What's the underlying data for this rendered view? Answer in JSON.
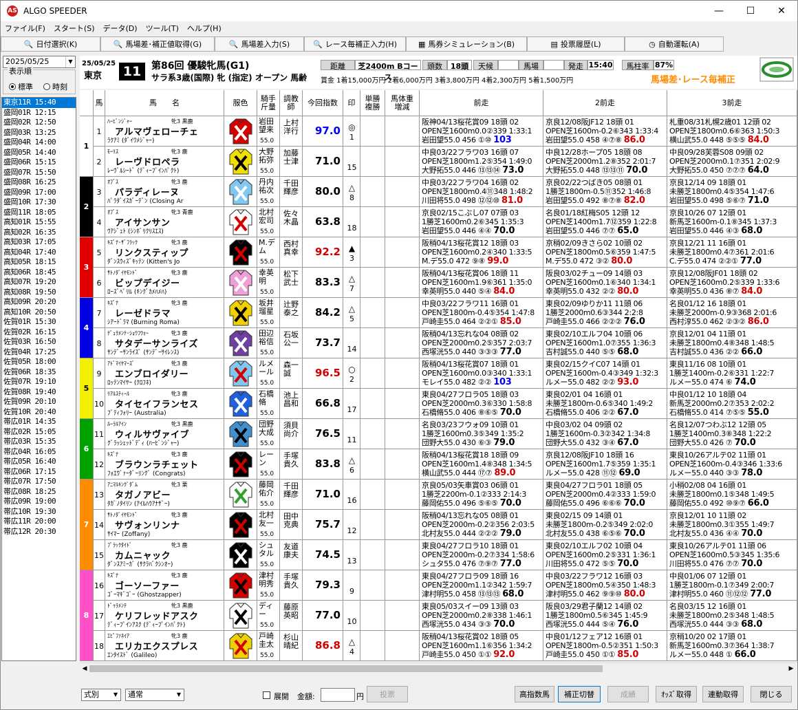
{
  "app": {
    "title": "ALGO SPEEDER",
    "logo": "AS"
  },
  "window_controls": {
    "minimize": "—",
    "maximize": "☐",
    "close": "✕"
  },
  "menu": [
    "ファイル(F)",
    "スタート(S)",
    "データ(D)",
    "ツール(T)",
    "ヘルプ(H)"
  ],
  "toolbar": [
    {
      "label": "日付選択(K)",
      "icon": "search-icon"
    },
    {
      "label": "馬場差･補正値取得(G)",
      "icon": "search-icon"
    },
    {
      "label": "馬場差入力(S)",
      "icon": "search-icon"
    },
    {
      "label": "レース毎補正入力(H)",
      "icon": "search-icon"
    },
    {
      "label": "馬券シミュレーション(B)",
      "icon": "grid-icon"
    },
    {
      "label": "投票履歴(L)",
      "icon": "doc-icon"
    },
    {
      "label": "自動運転(A)",
      "icon": "clock-icon"
    }
  ],
  "date_select": "2025/05/25",
  "order": {
    "legend": "表示順",
    "options": [
      "標準",
      "時刻"
    ],
    "selected": "標準"
  },
  "races": [
    "東京11R 15:40",
    "盛岡01R 12:15",
    "盛岡02R 12:50",
    "盛岡03R 13:25",
    "盛岡04R 14:00",
    "盛岡05R 14:40",
    "盛岡06R 15:15",
    "盛岡07R 15:50",
    "盛岡08R 16:25",
    "盛岡09R 17:00",
    "盛岡10R 17:30",
    "盛岡11R 18:05",
    "高知01R 15:55",
    "高知02R 16:35",
    "高知03R 17:05",
    "高知04R 17:40",
    "高知05R 18:15",
    "高知06R 18:45",
    "高知07R 19:20",
    "高知08R 19:50",
    "高知09R 20:20",
    "高知10R 20:50",
    "佐賀01R 15:30",
    "佐賀02R 16:15",
    "佐賀03R 16:50",
    "佐賀04R 17:25",
    "佐賀05R 18:00",
    "佐賀06R 18:35",
    "佐賀07R 19:10",
    "佐賀08R 19:40",
    "佐賀09R 20:10",
    "佐賀10R 20:40",
    "帯広01R 14:35",
    "帯広02R 15:05",
    "帯広03R 15:35",
    "帯広04R 16:05",
    "帯広05R 16:40",
    "帯広06R 17:15",
    "帯広07R 17:50",
    "帯広08R 18:25",
    "帯広09R 19:00",
    "帯広10R 19:30",
    "帯広11R 20:00",
    "帯広12R 20:30"
  ],
  "race": {
    "date": "25/05/25",
    "venue": "東京",
    "number": "11",
    "name": "第86回 優駿牝馬(G1)",
    "condition": "サラ系3歳(国際) 牝 (指定) オープン 馬齢",
    "distance_label": "距離",
    "distance": "芝2400m Bコース",
    "heads_label": "頭数",
    "heads": "18頭",
    "weather_label": "天候",
    "weather": "",
    "going_label": "馬場",
    "going": "",
    "post_label": "発走",
    "post": "15:40",
    "turf_label": "馬柱率",
    "turf": "87%",
    "prize": "賞金 1着15,000万円 2着6,000万円 3着3,800万円 4着2,300万円 5着1,500万円",
    "notice": "馬場差･レース毎補正"
  },
  "columns": {
    "waku": "",
    "num": "馬",
    "name": "馬　　名",
    "silk": "服色",
    "jockey": "騎手\n斤量",
    "trainer": "調教\n師",
    "index": "今回指数",
    "mark": "印",
    "odds": "単勝\n複勝",
    "weight": "馬体重\n増減",
    "p1": "前走",
    "p2": "2前走",
    "p3": "3前走"
  },
  "horses": [
    {
      "waku": 1,
      "num": "1",
      "sire": "ﾊｰﾋﾞﾝｼﾞｬｰ",
      "name": "アルマヴェローチェ",
      "sex": "牝3 黒鹿",
      "dam": "ﾗｸｱﾐ (ﾀﾞｲﾜﾒｼﾞｬｰ)",
      "jockey": "岩田望来",
      "jw": "55.0",
      "trainer": "上村洋行",
      "index": "97.0",
      "ic": "#0000ff",
      "mark": "◎",
      "pop": "1",
      "silk": "#d40000",
      "silk2": "#ffffff",
      "p1": [
        "阪神04/13桜花賞09 18頭 02",
        "OPEN芝1600m0.0②339 1:33:1",
        "岩田望55.0 456 ①⑩ 103"
      ],
      "p2": [
        "京良12/08阪JF12 18頭 01",
        "OPEN芝1600m-0.2⑥343 1:33:4",
        "岩田望55.0 458 ④⑦⑧ 86.0"
      ],
      "p3": [
        "札重08/31札幌2歳01 12頭 02",
        "OPEN芝1800m0.6⑥363 1:50:3",
        "横山武55.0 448 ⑤⑤⑤ 84.0"
      ]
    },
    {
      "waku": 1,
      "num": "2",
      "sire": "ﾓｰﾘｽ",
      "name": "レーヴドロペラ",
      "sex": "牝3 鹿",
      "dam": "ﾚｰｳﾞﾙｼｰﾄﾞ (ﾃﾞｨｰﾌﾟｲﾝﾊﾟｸﾄ)",
      "jockey": "大野拓弥",
      "jw": "55.0",
      "trainer": "加藤士津",
      "index": "71.0",
      "ic": "#000000",
      "mark": "",
      "pop": "15",
      "silk": "#f0e000",
      "silk2": "#000000",
      "p1": [
        "中良03/22フラワ03 16頭 07",
        "OPEN芝1800m1.2⑤354 1:49:0",
        "大野拓55.0 446 ⑬⑬⑭ 73.0"
      ],
      "p2": [
        "中良12/28ホープ05 18頭 08",
        "OPEN芝2000m1.2⑧352 2:01:7",
        "大野拓55.0 448 ⑬⑬⑪ 70.0"
      ],
      "p3": [
        "中良09/28芙蓉S08 09頭 02",
        "OPEN芝2000m0.1⑦351 2:02:9",
        "大野拓55.0 450 ⑦⑦⑦ 64.0"
      ]
    },
    {
      "waku": 2,
      "num": "3",
      "sire": "ｵﾌﾞｽ",
      "name": "パラディレーヌ",
      "sex": "牝3 鹿",
      "dam": "ﾊﾟﾗﾀﾞｲｽｶﾞｰﾃﾞﾝ (Closing Ar",
      "jockey": "丹内祐次",
      "jw": "55.0",
      "trainer": "千田輝彦",
      "index": "80.0",
      "ic": "#000000",
      "mark": "△",
      "pop": "8",
      "silk": "#80c8f0",
      "silk2": "#ffffff",
      "p1": [
        "中良03/22フラワ04 16頭 02",
        "OPEN芝1800m0.4⑪348 1:48:2",
        "川田将55.0 498 ⑫⑫⑩ 81.0"
      ],
      "p2": [
        "京良02/22つばき05 08頭 01",
        "1勝芝1800m-0.5⑪352 1:46:8",
        "岩田望55.0 492 ⑧⑦⑧ 82.0"
      ],
      "p3": [
        "京良12/14 09 18頭 01",
        "未勝芝1800m0.4⑤354 1:47:6",
        "岩田望55.0 498 ⑤⑥⑦ 71.0"
      ]
    },
    {
      "waku": 2,
      "num": "4",
      "sire": "ｵﾌﾞｽ",
      "name": "アイサンサン",
      "sex": "牝3 青鹿",
      "dam": "ｳｱｼﾞｪﾄ (ｼﾝﾎﾞﾘｸﾘｽｴｽ)",
      "jockey": "北村宏司",
      "jw": "55.0",
      "trainer": "佐々木晶",
      "index": "63.8",
      "ic": "#000000",
      "mark": "",
      "pop": "18",
      "silk": "#ffffff",
      "silk2": "#d40000",
      "p1": [
        "京良02/15こぶし07 07頭 03",
        "1勝芝1600m0.2⑥345 1:35:3",
        "岩田望55.0 446 ④④ 70.0"
      ],
      "p2": [
        "名良01/18紅梅S05 12頭 12",
        "OPEN芝1400m1.7⑫359 1:22:8",
        "岩田望55.0 446 ⑦⑦ 65.0"
      ],
      "p3": [
        "京良10/26 07 12頭 01",
        "新馬芝1600m-0.1⑧345 1:37:3",
        "岩田望55.0 446 ④③ 68.0"
      ]
    },
    {
      "waku": 3,
      "num": "5",
      "sire": "ｷｽﾞﾅ･ｻﾞﾌﾗｯｸ",
      "name": "リンクスティップ",
      "sex": "牝3 鹿",
      "dam": "ﾀﾞﾝｽｳｨｽﾞｷｯﾃﾝ (Kitten's Jo",
      "jockey": "M.デム",
      "jw": "55.0",
      "trainer": "西村真幸",
      "index": "92.2",
      "ic": "#d40000",
      "mark": "▲",
      "pop": "3",
      "silk": "#000000",
      "silk2": "#d40000",
      "p1": [
        "阪稍04/13桜花賞12 18頭 03",
        "OPEN芝1600m0.2④340 1:33:5",
        "M.デ55.0 472 ⑨⑧ 99.0"
      ],
      "p2": [
        "京稍02/09きさら02 10頭 02",
        "OPEN芝1800m0.5⑥359 1:47:5",
        "M.デ55.0 472 ③② 80.0"
      ],
      "p3": [
        "京良12/21 11 16頭 01",
        "未勝芝1800m0.4⑦361 2:01:6",
        "C.デ55.0 474 ②②① 77.0"
      ]
    },
    {
      "waku": 3,
      "num": "6",
      "sire": "ｻﾄﾉﾀﾞｲﾔﾓﾝﾄﾞ",
      "name": "ビップデイジー",
      "sex": "牝3 鹿",
      "dam": "ﾛｰｽﾞﾍﾟﾘﾙ (ｷﾝｸﾞｶﾒﾊﾒﾊ)",
      "jockey": "幸英明",
      "jw": "55.0",
      "trainer": "松下武士",
      "index": "83.3",
      "ic": "#000000",
      "mark": "△",
      "pop": "7",
      "silk": "#f0a0d8",
      "silk2": "#ffffff",
      "p1": [
        "阪稍04/13桜花賞06 18頭 11",
        "OPEN芝1600m1.9⑥361 1:35:0",
        "幸英明55.0 440 ⑤④ 84.0"
      ],
      "p2": [
        "阪良03/02チュー09 14頭 03",
        "OPEN芝1600m0.1⑥340 1:34:1",
        "幸英明55.0 432 ②② 80.0"
      ],
      "p3": [
        "京良12/08阪JF01 18頭 02",
        "OPEN芝1600m0.2⑤339 1:33:6",
        "幸英明55.0 436 ⑧⑦ 84.0"
      ]
    },
    {
      "waku": 4,
      "num": "7",
      "sire": "ｷｽﾞﾅ",
      "name": "レーゼドラマ",
      "sex": "牝3 鹿",
      "dam": "ｼｱｰﾄﾞﾗﾏ (Burning Roma)",
      "jockey": "坂井瑠星",
      "jw": "55.0",
      "trainer": "辻野泰之",
      "index": "84.2",
      "ic": "#000000",
      "mark": "△",
      "pop": "5",
      "silk": "#f0d000",
      "silk2": "#000000",
      "p1": [
        "中良03/22フラワ11 16頭 01",
        "OPEN芝1800m-0.4⑤354 1:47:8",
        "戸崎圭55.0 464 ②②① 85.0"
      ],
      "p2": [
        "東良02/09ゆりか11 11頭 06",
        "1勝芝2000m0.6③344 2:2:8",
        "戸崎圭55.0 466 ②②② 76.0"
      ],
      "p3": [
        "名良01/12 16 18頭 01",
        "未勝芝2000m-0.9③368 2:01:6",
        "西村淳55.0 462 ②③② 86.0"
      ]
    },
    {
      "waku": 4,
      "num": "8",
      "sire": "ﾃﾞｭﾗﾒﾝﾃ･ｼｮｳﾌｳｫｰ",
      "name": "サタデーサンライズ",
      "sex": "牝3 鹿",
      "dam": "ｻﾝﾃﾞｰｻﾝﾗｲｽﾞ (ｻﾝﾃﾞｰｻｲﾚﾝｽ)",
      "jockey": "田辺裕信",
      "jw": "55.0",
      "trainer": "石坂公一",
      "index": "73.7",
      "ic": "#000000",
      "mark": "",
      "pop": "14",
      "silk": "#7040a0",
      "silk2": "#ffffff",
      "p1": [
        "阪稍04/13忘れな04 08頭 02",
        "OPEN芝2000m0.2⑤357 2:03:7",
        "西塚洸55.0 440 ③③③ 77.0"
      ],
      "p2": [
        "東良02/10エルフ04 10頭 06",
        "OPEN芝1600m1.0⑦355 1:36:3",
        "吉村誠55.0 440 ⑤⑤ 68.0"
      ],
      "p3": [
        "京良12/01 04 11頭 01",
        "未勝芝1800m0.4⑧348 1:48:5",
        "吉村誠55.0 436 ②② 66.0"
      ]
    },
    {
      "waku": 5,
      "num": "9",
      "sire": "ｱﾄﾞﾏｲﾔﾏｰｽﾞ",
      "name": "エンブロイダリー",
      "sex": "牝3 鹿",
      "dam": "ﾛｯﾃﾝﾏｲﾔｰ (ｸﾛﾌﾈ)",
      "jockey": "ルメール",
      "jw": "55.0",
      "trainer": "森一誠",
      "index": "96.5",
      "ic": "#d40000",
      "mark": "○",
      "pop": "2",
      "silk": "#80c8f0",
      "silk2": "#d40000",
      "p1": [
        "阪稍04/13桜花賞07 18頭 01",
        "OPEN芝1600m0.0③340 1:33:1",
        "モレイ55.0 482 ②② 103"
      ],
      "p2": [
        "東良02/15クイC07 14頭 01",
        "OPEN芝1600m-0.4③349 1:32:3",
        "ルメー55.0 482 ②② 93.0"
      ],
      "p3": [
        "東良11/16 08 10頭 01",
        "1勝芝1400m-0.2⑥331 1:22:7",
        "ルメー55.0 474 ⑥ 74.0"
      ]
    },
    {
      "waku": 5,
      "num": "10",
      "sire": "ﾘｱﾙｽﾃｨｰﾙ",
      "name": "タイセイフランセス",
      "sex": "牝3 鹿",
      "dam": "ﾌﾞﾃｨﾌｫﾘｰ (Australia)",
      "jockey": "石橋脩",
      "jw": "55.0",
      "trainer": "池上昌和",
      "index": "66.8",
      "ic": "#000000",
      "mark": "",
      "pop": "17",
      "silk": "#2060e0",
      "silk2": "#ffffff",
      "p1": [
        "東良04/27フロラ05 18頭 03",
        "OPEN芝2000m0.3⑥330 1:58:8",
        "石橋脩55.0 406 ⑧⑥⑤ 70.0"
      ],
      "p2": [
        "東良02/01 04 16頭 01",
        "未勝芝1800m-0.6⑤340 1:49:2",
        "石橋脩55.0 406 ②② 67.0"
      ],
      "p3": [
        "中良01/12 10 18頭 04",
        "新馬芝2000m0.2⑦353 2:02:2",
        "石橋脩55.0 414 ⑦⑤⑤ 55.0"
      ]
    },
    {
      "waku": 6,
      "num": "11",
      "sire": "ﾙｰﾗﾙｱｲﾝ",
      "name": "ウィルサヴァイブ",
      "sex": "牝3 黒鹿",
      "dam": "ｸﾞﾗｯｼｪｯﾄﾞﾃﾞｨ (ﾊｰﾋﾞﾝｼﾞｬｰ)",
      "jockey": "団野大成",
      "jw": "55.0",
      "trainer": "須貝尚介",
      "index": "76.5",
      "ic": "#000000",
      "mark": "",
      "pop": "11",
      "silk": "#4090d0",
      "silk2": "#000000",
      "p1": [
        "名良03/23フウォ09 10頭 01",
        "1勝芝1600m0.3⑤349 1:35:2",
        "団野大55.0 430 ⑥③ 79.0"
      ],
      "p2": [
        "中良03/02 04 09頭 02",
        "1勝芝1600m-0.3②342 1:34:8",
        "団野大55.0 432 ③④ 67.0"
      ],
      "p3": [
        "名良12/07つわぶ12 12頭 05",
        "1勝芝1400m0.3⑧348 1:22:2",
        "団野大55.0 426 ⑦ 70.0"
      ]
    },
    {
      "waku": 6,
      "num": "12",
      "sire": "ｷｽﾞﾅ",
      "name": "ブラウンラチェット",
      "sex": "牝3 鹿",
      "dam": "ﾌｫｴｳﾞｧｰﾀﾞｰﾘﾝｸﾞ (Congrats)",
      "jockey": "レーン",
      "jw": "55.0",
      "trainer": "手塚貴久",
      "index": "83.8",
      "ic": "#000000",
      "mark": "△",
      "pop": "6",
      "silk": "#000000",
      "silk2": "#d40000",
      "p1": [
        "阪稍04/13桜花賞18 18頭 09",
        "OPEN芝1600m1.4⑧348 1:34:5",
        "横山武55.0 444 ⑰⑦ 89.0"
      ],
      "p2": [
        "京良12/08阪JF10 18頭 16",
        "OPEN芝1600m1.7⑤359 1:35:1",
        "ルメー55.0 428 ⑪⑫ 69.0"
      ],
      "p3": [
        "東良10/26アルテ02 11頭 01",
        "OPEN芝1600m-0.4③346 1:33:6",
        "ルメー55.0 440 ③③ 78.0"
      ]
    },
    {
      "waku": 7,
      "num": "13",
      "sire": "ｱﾆﾏﾙｷﾝｸﾞﾀﾞﾑ",
      "name": "タガノアビー",
      "sex": "牝3 栗",
      "dam": "ﾀｶﾞﾉﾀｲﾘﾝ (ｱｲﾙﾊｳｱﾅｻﾞｰ)",
      "jockey": "藤岡佑介",
      "jw": "55.0",
      "trainer": "千田輝彦",
      "index": "71.0",
      "ic": "#000000",
      "mark": "",
      "pop": "16",
      "silk": "#ffffff",
      "silk2": "#30a030",
      "p1": [
        "京良05/03矢車賞03 06頭 01",
        "1勝芝2200m-0.1②333 2:14:3",
        "藤岡佑55.0 496 ⑤⑥⑤ 70.0"
      ],
      "p2": [
        "東良04/27フロラ01 18頭 05",
        "OPEN芝2000m0.4②333 1:59:0",
        "藤岡佑55.0 496 ⑥⑥⑥ 70.0"
      ],
      "p3": [
        "小稍02/08 04 16頭 01",
        "未勝芝1800m0.1⑤348 1:49:5",
        "藤岡佑55.0 492 ⑩⑨⑦ 66.0"
      ]
    },
    {
      "waku": 7,
      "num": "14",
      "sire": "ｻﾄﾉﾀﾞｲﾔﾓﾝﾄﾞ",
      "name": "サヴォンリンナ",
      "sex": "牝3 鹿",
      "dam": "ｻｲﾏｰ (Zoffany)",
      "jockey": "北村友一",
      "jw": "55.0",
      "trainer": "田中克典",
      "index": "75.7",
      "ic": "#000000",
      "mark": "",
      "pop": "12",
      "silk": "#000000",
      "silk2": "#d40000",
      "p1": [
        "阪稍04/13忘れな05 08頭 01",
        "OPEN芝2000m-0.2②356 2:03:5",
        "北村友55.0 444 ②②② 79.0"
      ],
      "p2": [
        "東良02/15 09 14頭 01",
        "未勝芝1800m-0.2⑤349 2:02:0",
        "北村友55.0 438 ⑥⑤⑥ 70.0"
      ],
      "p3": [
        "京良12/01 10 11頭 02",
        "未勝芝1800m0.3①355 1:49:7",
        "北村友55.0 436 ④④ 70.0"
      ]
    },
    {
      "waku": 7,
      "num": "15",
      "sire": "ﾌﾞﾗｯｸﾀｲﾄﾞ",
      "name": "カムニャック",
      "sex": "牝3 鹿",
      "dam": "ﾀﾞﾝｽｱﾐｰｶﾞ (ｻｸﾗﾊﾞｸｼﾝｵｰ)",
      "jockey": "シュタル",
      "jw": "55.0",
      "trainer": "友道康夫",
      "index": "74.5",
      "ic": "#000000",
      "mark": "",
      "pop": "13",
      "silk": "#000000",
      "silk2": "#ffffff",
      "p1": [
        "東良04/27フロラ10 18頭 01",
        "OPEN芝2000m-0.2⑦334 1:58:6",
        "シュタ55.0 476 ⑦⑨⑦ 77.0"
      ],
      "p2": [
        "東良02/10エルフ02 10頭 04",
        "OPEN芝1600m0.2⑤331 1:36:1",
        "川田将55.0 472 ⑤⑤ 70.0"
      ],
      "p3": [
        "東良10/26アルテ01 11頭 06",
        "OPEN芝1600m0.5③345 1:35:6",
        "川田将55.0 476 ⑦⑦ 70.0"
      ]
    },
    {
      "waku": 8,
      "num": "16",
      "sire": "ｷｽﾞﾅ",
      "name": "ゴーソーファー",
      "sex": "牝3 鹿",
      "dam": "ｺﾞｰﾏｷﾞｺﾞｰ (Ghostzapper)",
      "jockey": "津村明秀",
      "jw": "55.0",
      "trainer": "手塚貴久",
      "index": "79.3",
      "ic": "#000000",
      "mark": "",
      "pop": "9",
      "silk": "#d40000",
      "silk2": "#000000",
      "p1": [
        "東良04/27フロラ09 18頭 16",
        "OPEN芝2000m1.1②342 1:59:7",
        "津村明55.0 458 ⑬⑬⑬ 68.0"
      ],
      "p2": [
        "中良03/22フラワ12 16頭 03",
        "OPEN芝1800m0.5④350 1:48:3",
        "津村明55.0 462 ⑨⑨⑩ 80.0"
      ],
      "p3": [
        "中良01/06 07 12頭 01",
        "1勝芝1800m-0.1⑦349 2:00:7",
        "津村明55.0 460 ⑪⑫⑫ 77.0"
      ]
    },
    {
      "waku": 8,
      "num": "17",
      "sire": "ﾄﾞｩﾗﾒﾝﾃ",
      "name": "ケリフレッドアスク",
      "sex": "牝3 黒鹿",
      "dam": "ﾃﾞｨｰﾌﾟｲﾝｱｽｸ (ﾃﾞｨｰﾌﾟｲﾝﾊﾟｸﾄ)",
      "jockey": "ディー",
      "jw": "55.0",
      "trainer": "藤原英昭",
      "index": "77.0",
      "ic": "#000000",
      "mark": "",
      "pop": "10",
      "silk": "#ffffff",
      "silk2": "#000000",
      "p1": [
        "東良05/03スイー09 13頭 03",
        "OPEN芝2000m0.2⑧338 1:46:1",
        "西塚洸55.0 434 ③③ 70.0"
      ],
      "p2": [
        "阪良03/29君子蘭12 14頭 02",
        "1勝芝1800m0.5⑥345 1:45:9",
        "西塚洸55.0 444 ⑤④ 76.0"
      ],
      "p3": [
        "名良03/15 12 16頭 01",
        "未勝芝1800m0.2⑤348 1:48:5",
        "西塚洸55.0 444 ③③ 68.0"
      ]
    },
    {
      "waku": 8,
      "num": "18",
      "sire": "ｴﾋﾟﾌｧﾈｲｱ",
      "name": "エリカエクスプレス",
      "sex": "牝3 鹿",
      "dam": "ｴﾝﾀｲｽﾄﾞ (Galileo)",
      "jockey": "戸崎圭太",
      "jw": "55.0",
      "trainer": "杉山晴紀",
      "index": "86.8",
      "ic": "#d40000",
      "mark": "△",
      "pop": "4",
      "silk": "#f0d000",
      "silk2": "#d40000",
      "p1": [
        "阪稍04/13桜花賞02 18頭 05",
        "OPEN芝1600m1.1⑥356 1:34:2",
        "戸崎圭55.0 450 ①① 92.0"
      ],
      "p2": [
        "中良01/12フェア12 16頭 01",
        "OPEN芝1800m-0.5②351 1:50:3",
        "戸崎圭55.0 450 ①① 85.0"
      ],
      "p3": [
        "京稍10/20 02 17頭 01",
        "新馬芝1600m0.3⑦364 1:38:7",
        "ルメー55.0 448 ① 66.0"
      ]
    }
  ],
  "waku_colors": {
    "1": "#ffffff",
    "2": "#000000",
    "3": "#e00000",
    "4": "#0000e0",
    "5": "#f0f000",
    "6": "#00a000",
    "7": "#ff8c00",
    "8": "#ff50c8"
  },
  "bottom": {
    "sel1": "式別",
    "sel2": "通常",
    "expand": "展開",
    "amount_label": "金額:",
    "yen": "円",
    "vote": "投票",
    "b1": "高指数馬",
    "b2": "補正切替",
    "b3": "成績",
    "b4": "ｵｯｽﾞ取得",
    "b5": "連動取得",
    "b6": "閉じる"
  }
}
